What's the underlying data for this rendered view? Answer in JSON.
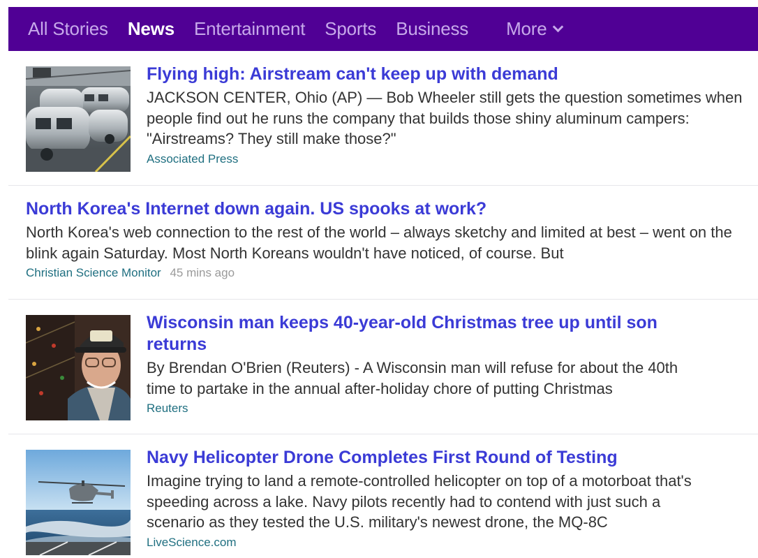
{
  "nav": {
    "tabs": [
      {
        "label": "All Stories",
        "active": false
      },
      {
        "label": "News",
        "active": true
      },
      {
        "label": "Entertainment",
        "active": false
      },
      {
        "label": "Sports",
        "active": false
      },
      {
        "label": "Business",
        "active": false
      }
    ],
    "more_label": "More",
    "more_icon": "chevron-down-icon"
  },
  "colors": {
    "nav_background": "#500095",
    "nav_active_text": "#ffffff",
    "nav_inactive_text": "#c7a9ea",
    "headline": "#3b3bd6",
    "source": "#1f6f80",
    "timestamp": "#9a9a9a"
  },
  "stories": [
    {
      "headline": "Flying high: Airstream can't keep up with demand",
      "summary": "JACKSON CENTER, Ohio (AP) — Bob Wheeler still gets the question sometimes when people find out he runs the company that builds those shiny aluminum campers: \"Airstreams? They still make those?\"",
      "source": "Associated Press",
      "age": "",
      "thumbnail": "factory-campers-photo"
    },
    {
      "headline": "North Korea's Internet down again. US spooks at work?",
      "summary": "North Korea's web connection to the rest of the world – always sketchy and limited at best – went on the blink again Saturday. Most North Koreans wouldn't have noticed, of course. But",
      "source": "Christian Science Monitor",
      "age": "45 mins ago",
      "thumbnail": ""
    },
    {
      "headline": "Wisconsin man keeps 40-year-old Christmas tree up until son returns",
      "summary": "By Brendan O'Brien (Reuters) - A Wisconsin man will refuse for about the 40th time to partake in the annual after-holiday chore of putting Christmas",
      "source": "Reuters",
      "age": "",
      "thumbnail": "man-with-cap-photo"
    },
    {
      "headline": "Navy Helicopter Drone Completes First Round of Testing",
      "summary": "Imagine trying to land a remote-controlled helicopter on top of a motorboat that's speeding across a lake. Navy pilots recently had to contend with just such a scenario as they tested the U.S. military's newest drone, the MQ-8C",
      "source": "LiveScience.com",
      "age": "",
      "thumbnail": "helicopter-over-water-photo"
    }
  ]
}
